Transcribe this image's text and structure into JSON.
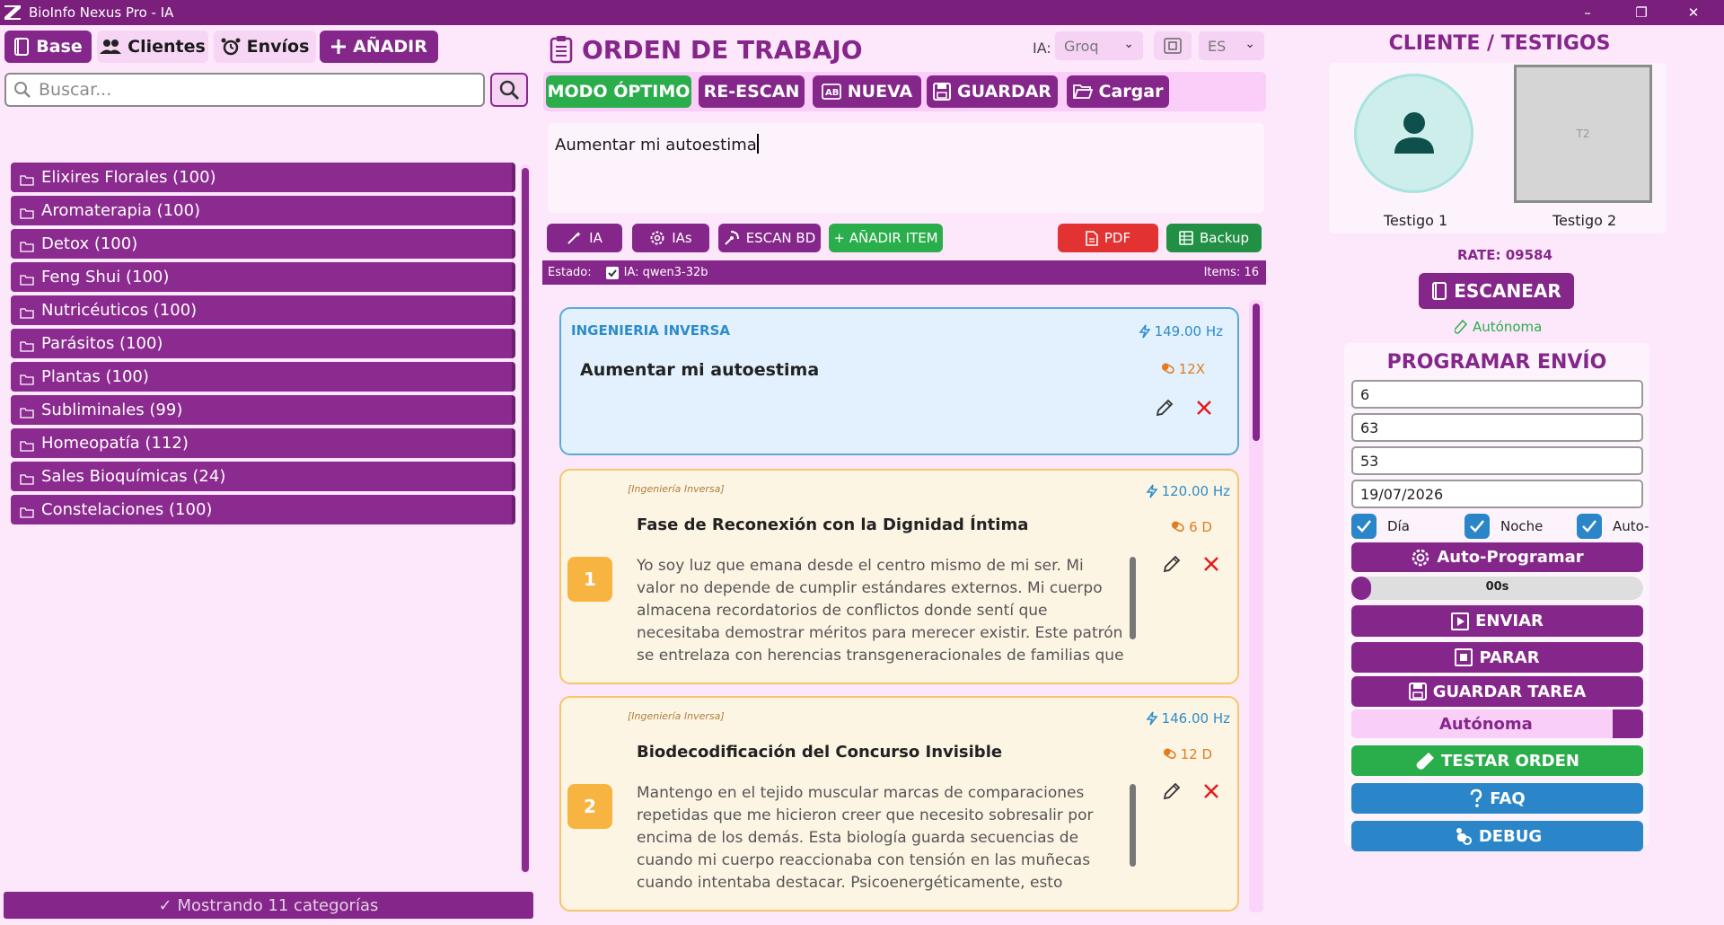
{
  "window": {
    "title": "BioInfo Nexus Pro - IA",
    "minimize": "–",
    "maximize": "❐",
    "close": "✕"
  },
  "nav": {
    "base": "Base",
    "clientes": "Clientes",
    "envios": "Envíos",
    "anadir": "AÑADIR"
  },
  "search": {
    "placeholder": "Buscar..."
  },
  "categories": [
    "Elixires Florales (100)",
    "Aromaterapia (100)",
    "Detox (100)",
    "Feng Shui (100)",
    "Nutricéuticos (100)",
    "Parásitos (100)",
    "Plantas (100)",
    "Subliminales (99)",
    "Homeopatía (112)",
    "Sales Bioquímicas (24)",
    "Constelaciones (100)"
  ],
  "left_footer": "✓ Mostrando 11 categorías",
  "order": {
    "title": "ORDEN DE TRABAJO",
    "ia_label": "IA:",
    "ia_select": "Groq",
    "lang_select": "ES",
    "toolbar": {
      "modo_optimo": "MODO ÓPTIMO",
      "re_escan": "RE-ESCAN",
      "nueva": "NUEVA",
      "guardar": "GUARDAR",
      "cargar": "Cargar"
    },
    "prompt_text": "Aumentar mi autoestima",
    "actions": {
      "ia": "IA",
      "ias": "IAs",
      "escan_bd": "ESCAN BD",
      "anadir_item": "+ AÑADIR ITEM",
      "pdf": "PDF",
      "backup": "Backup"
    },
    "status": {
      "estado": "Estado:",
      "ia_model": "IA: qwen3-32b",
      "items": "Items: 16"
    }
  },
  "cards": {
    "main": {
      "kind": "INGENIERIA INVERSA",
      "hz": "149.00 Hz",
      "title": "Aumentar mi autoestima",
      "dose": "12X"
    },
    "items": [
      {
        "tag": "[Ingeniería Inversa]",
        "hz": "120.00 Hz",
        "title": "Fase de Reconexión con la Dignidad Íntima",
        "dose": "6 D",
        "num": "1",
        "body": "Yo soy luz que emana desde el centro mismo de mi ser. Mi valor no depende de cumplir estándares externos. Mi cuerpo almacena recordatorios de conflictos donde sentí que necesitaba demostrar méritos para merecer existir. Este patrón se entrelaza con herencias transgeneracionales de familias que definieron la importancia por la"
      },
      {
        "tag": "[Ingeniería Inversa]",
        "hz": "146.00 Hz",
        "title": "Biodecodificación del Concurso Invisible",
        "dose": "12 D",
        "num": "2",
        "body": "Mantengo en el tejido muscular marcas de comparaciones repetidas que me hicieron creer que necesito sobresalir por encima de los demás. Esta biología guarda secuencias de cuando mi cuerpo reaccionaba con tensión en las muñecas cuando intentaba destacar. Psicoenergéticamente, esto conecta con ascendientes que valoraban"
      }
    ]
  },
  "client": {
    "title": "CLIENTE / TESTIGOS",
    "witness1": "Testigo 1",
    "witness2": "Testigo 2",
    "t2_placeholder": "T2",
    "rate": "RATE: 09584",
    "escanear": "ESCANEAR",
    "autonoma_link": "Autónoma"
  },
  "schedule": {
    "title": "PROGRAMAR ENVÍO",
    "fields": [
      "6",
      "63",
      "53",
      "19/07/2026"
    ],
    "checks": {
      "dia": "Día",
      "noche": "Noche",
      "auto": "Auto-"
    },
    "auto_programar": "Auto-Programar",
    "progress_label": "00s",
    "progress_value": 0,
    "enviar": "ENVIAR",
    "parar": "PARAR",
    "guardar_tarea": "GUARDAR TAREA",
    "mode": "Autónoma",
    "testar_orden": "TESTAR ORDEN",
    "faq": "FAQ",
    "debug": "DEBUG"
  }
}
